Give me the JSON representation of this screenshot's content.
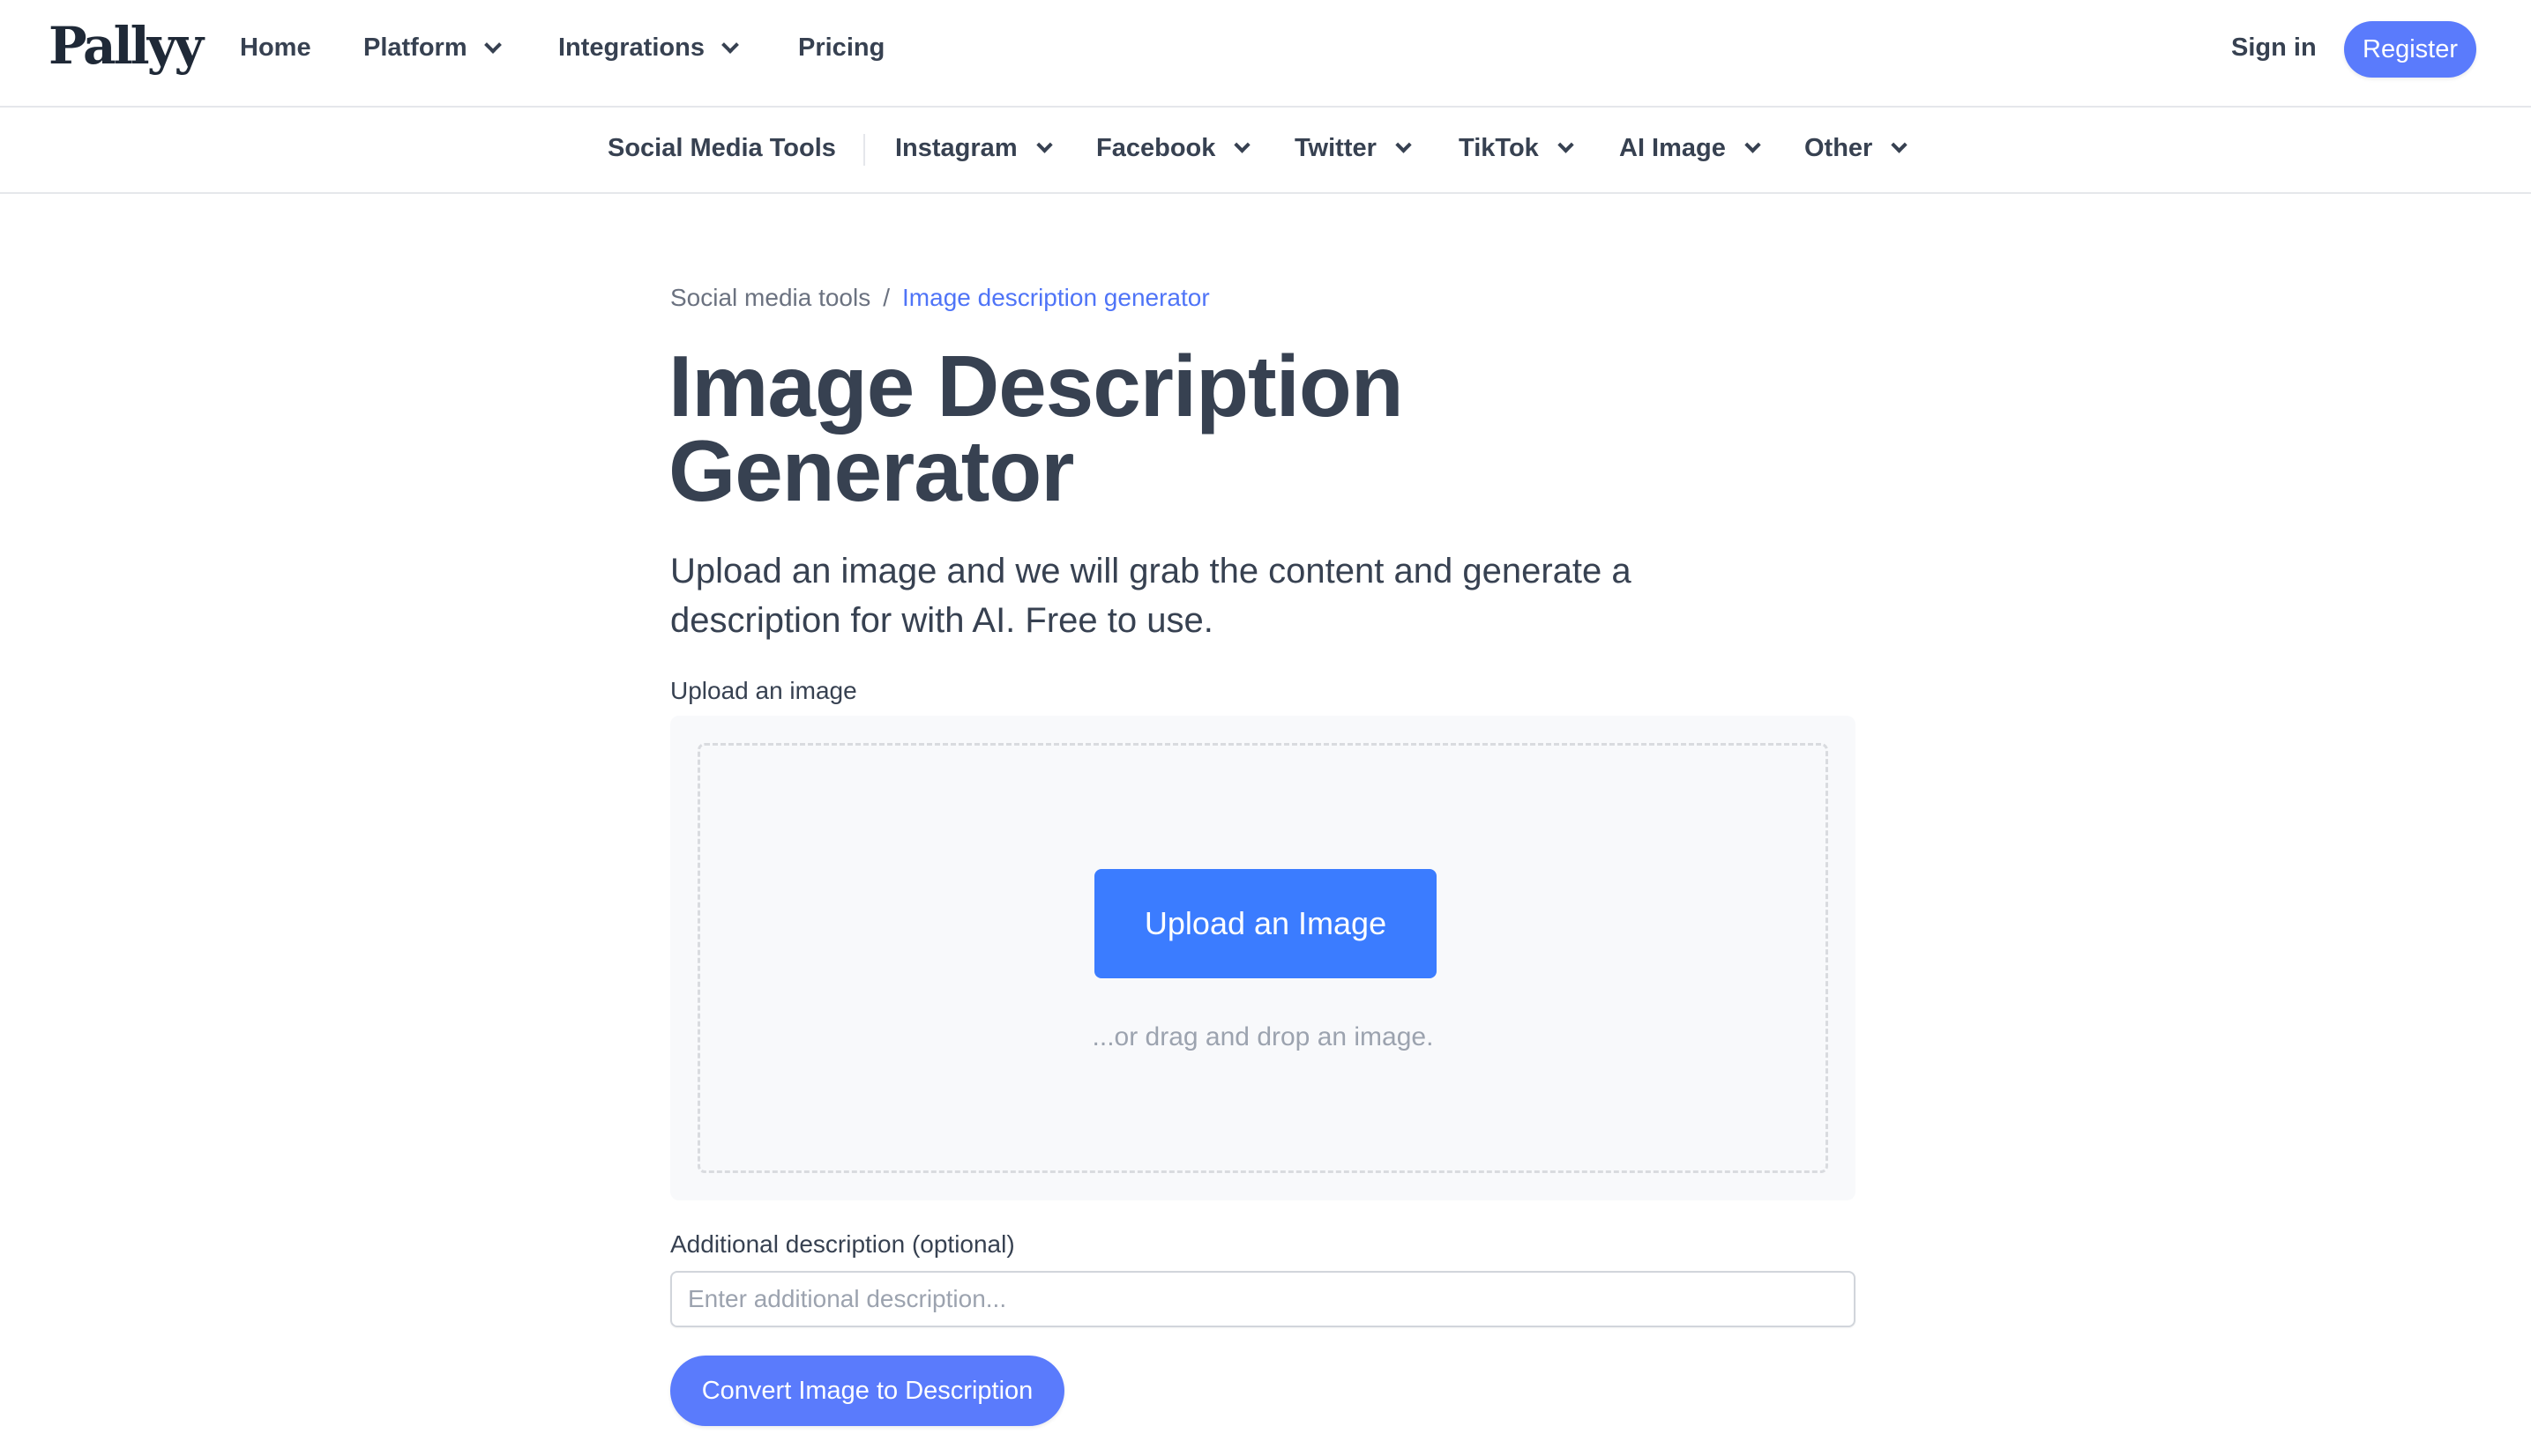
{
  "brand": {
    "logo_text": "Pallyy"
  },
  "topnav": {
    "items": [
      {
        "label": "Home",
        "has_dropdown": false
      },
      {
        "label": "Platform",
        "has_dropdown": true
      },
      {
        "label": "Integrations",
        "has_dropdown": true
      },
      {
        "label": "Pricing",
        "has_dropdown": false
      }
    ],
    "signin_label": "Sign in",
    "register_label": "Register"
  },
  "subnav": {
    "root_label": "Social Media Tools",
    "items": [
      {
        "label": "Instagram",
        "has_dropdown": true
      },
      {
        "label": "Facebook",
        "has_dropdown": true
      },
      {
        "label": "Twitter",
        "has_dropdown": true
      },
      {
        "label": "TikTok",
        "has_dropdown": true
      },
      {
        "label": "AI Image",
        "has_dropdown": true
      },
      {
        "label": "Other",
        "has_dropdown": true
      }
    ]
  },
  "breadcrumb": {
    "root": "Social media tools",
    "separator": "/",
    "current": "Image description generator"
  },
  "page": {
    "title_line1": "Image Description",
    "title_line2": "Generator",
    "subtitle_line1": "Upload an image and we will grab the content and generate a",
    "subtitle_line2": "description for with AI. Free to use."
  },
  "upload": {
    "label": "Upload an image",
    "button_label": "Upload an Image",
    "drag_text": "...or drag and drop an image."
  },
  "additional": {
    "label": "Additional description (optional)",
    "value": "",
    "placeholder": "Enter additional description..."
  },
  "convert_button_label": "Convert Image to Description",
  "colors": {
    "accent": "#5a7bfc",
    "upload_button": "#3b7cff",
    "breadcrumb_active": "#4f74f7",
    "text": "#374151"
  }
}
